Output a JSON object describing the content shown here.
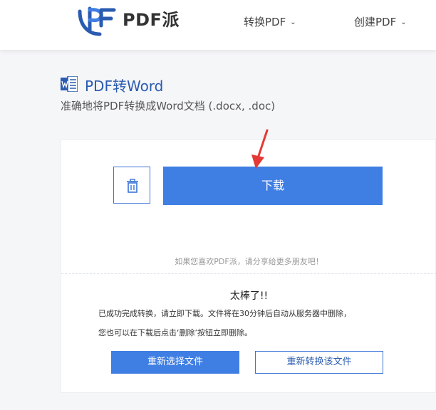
{
  "header": {
    "brand": "PDF派",
    "nav": {
      "convert_label": "转换PDF",
      "create_label": "创建PDF"
    }
  },
  "page": {
    "title": "PDF转Word",
    "subtitle": "准确地将PDF转换成Word文档 (.docx, .doc)"
  },
  "card": {
    "download_label": "下载",
    "share_text": "如果您喜欢PDF派，请分享给更多朋友吧！",
    "success_title": "太棒了!!",
    "message_line1": "已成功完成转换，请立即下载。文件将在30分钟后自动从服务器中删除，",
    "message_line2": "您也可以在下载后点击‘删除’按钮立即删除。",
    "reselect_label": "重新选择文件",
    "reconvert_label": "重新转换该文件"
  },
  "colors": {
    "primary": "#3f7ee3",
    "title_blue": "#2a5bb0",
    "arrow_red": "#e53935"
  },
  "icons": {
    "logo": "pdfpai-logo-icon",
    "word": "word-doc-icon",
    "delete": "trash-icon",
    "pointer": "red-arrow-icon"
  }
}
